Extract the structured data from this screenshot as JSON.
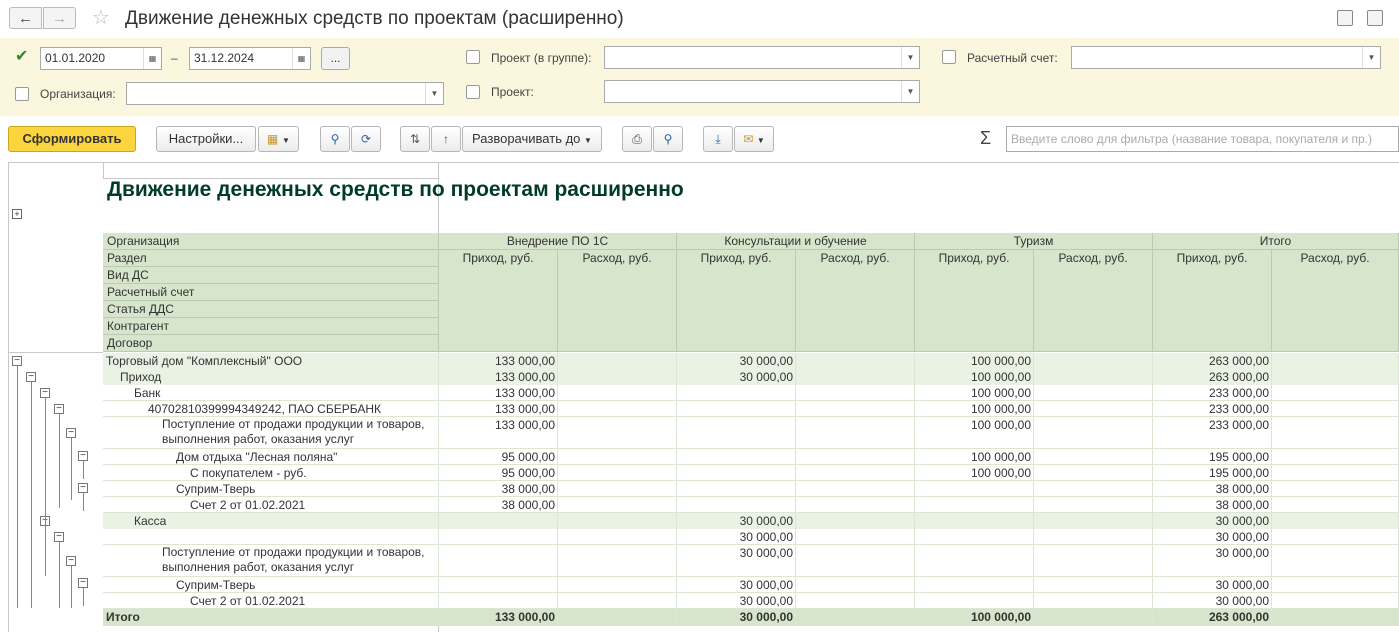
{
  "window": {
    "title": "Движение денежных средств по проектам (расширенно)"
  },
  "filters": {
    "period_from": "01.01.2020",
    "period_dash": "–",
    "period_to": "31.12.2024",
    "period_more": "...",
    "org_label": "Организация:",
    "org_value": "",
    "project_group_label": "Проект (в группе):",
    "project_group_value": "",
    "project_label": "Проект:",
    "project_value": "",
    "account_label": "Расчетный счет:",
    "account_value": ""
  },
  "toolbar": {
    "generate_label": "Сформировать",
    "settings_label": "Настройки...",
    "expand_label": "Разворачивать до",
    "search_placeholder": "Введите слово для фильтра (название товара, покупателя и пр.)"
  },
  "report": {
    "title": "Движение денежных средств по проектам расширенно",
    "row_dims": [
      "Организация",
      "Раздел",
      "Вид ДС",
      "Расчетный счет",
      "Статья ДДС",
      "Контрагент",
      "Договор"
    ],
    "groups": [
      "Внедрение ПО 1С",
      "Консультации и обучение",
      "Туризм",
      "Итого"
    ],
    "income_label": "Приход, руб.",
    "expense_label": "Расход, руб.",
    "rows": [
      {
        "name": "Торговый дом \"Комплексный\" ООО",
        "v": [
          "133 000,00",
          "",
          "30 000,00",
          "",
          "100 000,00",
          "",
          "263 000,00",
          ""
        ]
      },
      {
        "name": "Приход",
        "v": [
          "133 000,00",
          "",
          "30 000,00",
          "",
          "100 000,00",
          "",
          "263 000,00",
          ""
        ]
      },
      {
        "name": "Банк",
        "v": [
          "133 000,00",
          "",
          "",
          "",
          "100 000,00",
          "",
          "233 000,00",
          ""
        ]
      },
      {
        "name": "40702810399994349242, ПАО СБЕРБАНК",
        "v": [
          "133 000,00",
          "",
          "",
          "",
          "100 000,00",
          "",
          "233 000,00",
          ""
        ]
      },
      {
        "name": "Поступление от продажи продукции и товаров, выполнения работ, оказания услуг",
        "v": [
          "133 000,00",
          "",
          "",
          "",
          "100 000,00",
          "",
          "233 000,00",
          ""
        ]
      },
      {
        "name": "Дом отдыха \"Лесная поляна\"",
        "v": [
          "95 000,00",
          "",
          "",
          "",
          "100 000,00",
          "",
          "195 000,00",
          ""
        ]
      },
      {
        "name": "С покупателем - руб.",
        "v": [
          "95 000,00",
          "",
          "",
          "",
          "100 000,00",
          "",
          "195 000,00",
          ""
        ]
      },
      {
        "name": "Суприм-Тверь",
        "v": [
          "38 000,00",
          "",
          "",
          "",
          "",
          "",
          "38 000,00",
          ""
        ]
      },
      {
        "name": "Счет 2 от 01.02.2021",
        "v": [
          "38 000,00",
          "",
          "",
          "",
          "",
          "",
          "38 000,00",
          ""
        ]
      },
      {
        "name": "Касса",
        "v": [
          "",
          "",
          "30 000,00",
          "",
          "",
          "",
          "30 000,00",
          ""
        ]
      },
      {
        "name": "",
        "v": [
          "",
          "",
          "30 000,00",
          "",
          "",
          "",
          "30 000,00",
          ""
        ]
      },
      {
        "name": "Поступление от продажи продукции и товаров, выполнения работ, оказания услуг",
        "v": [
          "",
          "",
          "30 000,00",
          "",
          "",
          "",
          "30 000,00",
          ""
        ]
      },
      {
        "name": "Суприм-Тверь",
        "v": [
          "",
          "",
          "30 000,00",
          "",
          "",
          "",
          "30 000,00",
          ""
        ]
      },
      {
        "name": "Счет 2 от 01.02.2021",
        "v": [
          "",
          "",
          "30 000,00",
          "",
          "",
          "",
          "30 000,00",
          ""
        ]
      },
      {
        "name": "Итого",
        "v": [
          "133 000,00",
          "",
          "30 000,00",
          "",
          "100 000,00",
          "",
          "263 000,00",
          ""
        ]
      }
    ]
  }
}
